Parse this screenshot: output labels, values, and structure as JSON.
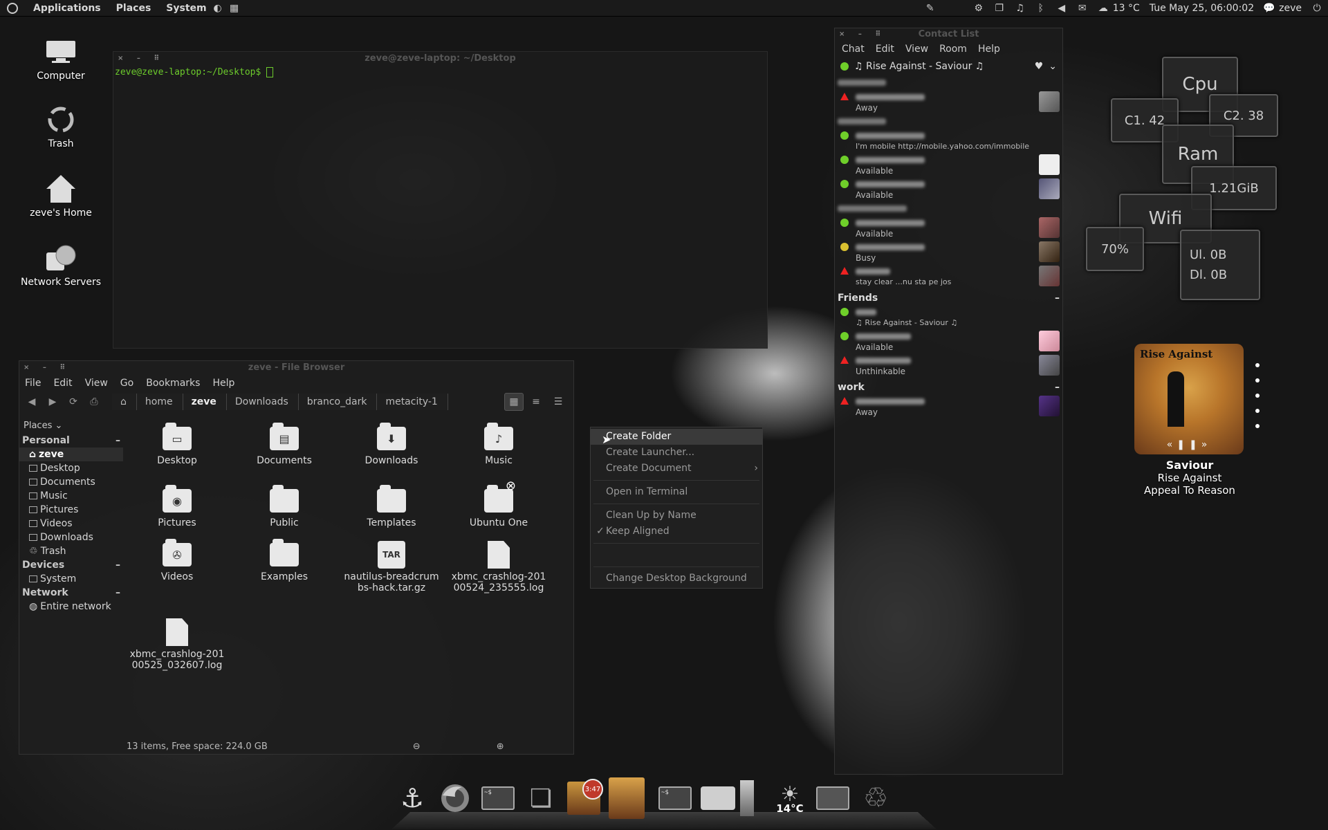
{
  "top_panel": {
    "menus": [
      "Applications",
      "Places",
      "System"
    ],
    "weather": "13 °C",
    "datetime": "Tue May 25, 06:00:02",
    "user": "zeve"
  },
  "desktop_icons": [
    {
      "label": "Computer",
      "icon": "computer-icon"
    },
    {
      "label": "Trash",
      "icon": "trash-icon"
    },
    {
      "label": "zeve's Home",
      "icon": "home-icon"
    },
    {
      "label": "Network Servers",
      "icon": "network-icon"
    }
  ],
  "terminal": {
    "title": "zeve@zeve-laptop: ~/Desktop",
    "prompt": "zeve@zeve-laptop:~/Desktop$ "
  },
  "file_browser": {
    "title": "zeve - File Browser",
    "menu": [
      "File",
      "Edit",
      "View",
      "Go",
      "Bookmarks",
      "Help"
    ],
    "breadcrumbs": [
      "home",
      "zeve",
      "Downloads",
      "branco_dark",
      "metacity-1"
    ],
    "active_crumb": "zeve",
    "places_label": "Places",
    "sidebar": {
      "personal": {
        "label": "Personal",
        "items": [
          "zeve",
          "Desktop",
          "Documents",
          "Music",
          "Pictures",
          "Videos",
          "Downloads",
          "Trash"
        ]
      },
      "devices": {
        "label": "Devices",
        "items": [
          "System"
        ]
      },
      "network": {
        "label": "Network",
        "items": [
          "Entire network"
        ]
      }
    },
    "files": [
      {
        "name": "Desktop",
        "type": "folder",
        "glyph": "▭"
      },
      {
        "name": "Documents",
        "type": "folder",
        "glyph": "▤"
      },
      {
        "name": "Downloads",
        "type": "folder",
        "glyph": "⬇"
      },
      {
        "name": "Music",
        "type": "folder",
        "glyph": "♪"
      },
      {
        "name": "Pictures",
        "type": "folder",
        "glyph": "◉"
      },
      {
        "name": "Public",
        "type": "folder",
        "glyph": ""
      },
      {
        "name": "Templates",
        "type": "folder",
        "glyph": ""
      },
      {
        "name": "Ubuntu One",
        "type": "folder",
        "glyph": ""
      },
      {
        "name": "Videos",
        "type": "folder",
        "glyph": "✇"
      },
      {
        "name": "Examples",
        "type": "folder",
        "glyph": ""
      },
      {
        "name": "nautilus-breadcrumbs-hack.tar.gz",
        "type": "tar",
        "glyph": "TAR"
      },
      {
        "name": "xbmc_crashlog-20100524_235555.log",
        "type": "doc",
        "glyph": ""
      },
      {
        "name": "xbmc_crashlog-20100525_032607.log",
        "type": "doc",
        "glyph": ""
      }
    ],
    "status": "13 items, Free space: 224.0 GB"
  },
  "context_menu": {
    "items": [
      "Create Folder",
      "Create Launcher...",
      "Create Document",
      "Open in Terminal",
      "Clean Up by Name",
      "Keep Aligned",
      "Change Desktop Background"
    ]
  },
  "contact_list": {
    "title": "Contact List",
    "menu": [
      "Chat",
      "Edit",
      "View",
      "Room",
      "Help"
    ],
    "my_status": "♫ Rise Against - Saviour ♫",
    "contacts": [
      {
        "status_text": "Away",
        "state": "away"
      },
      {
        "status_text": "I'm mobile http://mobile.yahoo.com/immobile",
        "state": "available"
      },
      {
        "status_text": "Available",
        "state": "available"
      },
      {
        "status_text": "Available",
        "state": "available"
      },
      {
        "status_text": "Available",
        "state": "available"
      },
      {
        "status_text": "Busy",
        "state": "busy"
      },
      {
        "status_text": "stay clear ...nu sta pe jos",
        "state": "away"
      }
    ],
    "groups": [
      {
        "name": "Friends",
        "contacts": [
          {
            "status_text": "♫ Rise Against - Saviour ♫",
            "state": "available"
          },
          {
            "status_text": "Available",
            "state": "available"
          },
          {
            "status_text": "Unthinkable",
            "state": "away"
          }
        ]
      },
      {
        "name": "work",
        "contacts": [
          {
            "status_text": "Away",
            "state": "away"
          }
        ]
      }
    ]
  },
  "system_monitor": {
    "cpu_label": "Cpu",
    "c1": "C1. 42",
    "c2": "C2. 38",
    "ram_label": "Ram",
    "ram_value": "1.21GiB",
    "wifi_label": "Wifi",
    "wifi_value": "70%",
    "upload": "Ul. 0B",
    "download": "Dl. 0B"
  },
  "music": {
    "album_band": "Rise Against",
    "title": "Saviour",
    "artist": "Rise Against",
    "album": "Appeal To Reason"
  },
  "dock": {
    "badge": "3:47",
    "weather": "14°C"
  }
}
